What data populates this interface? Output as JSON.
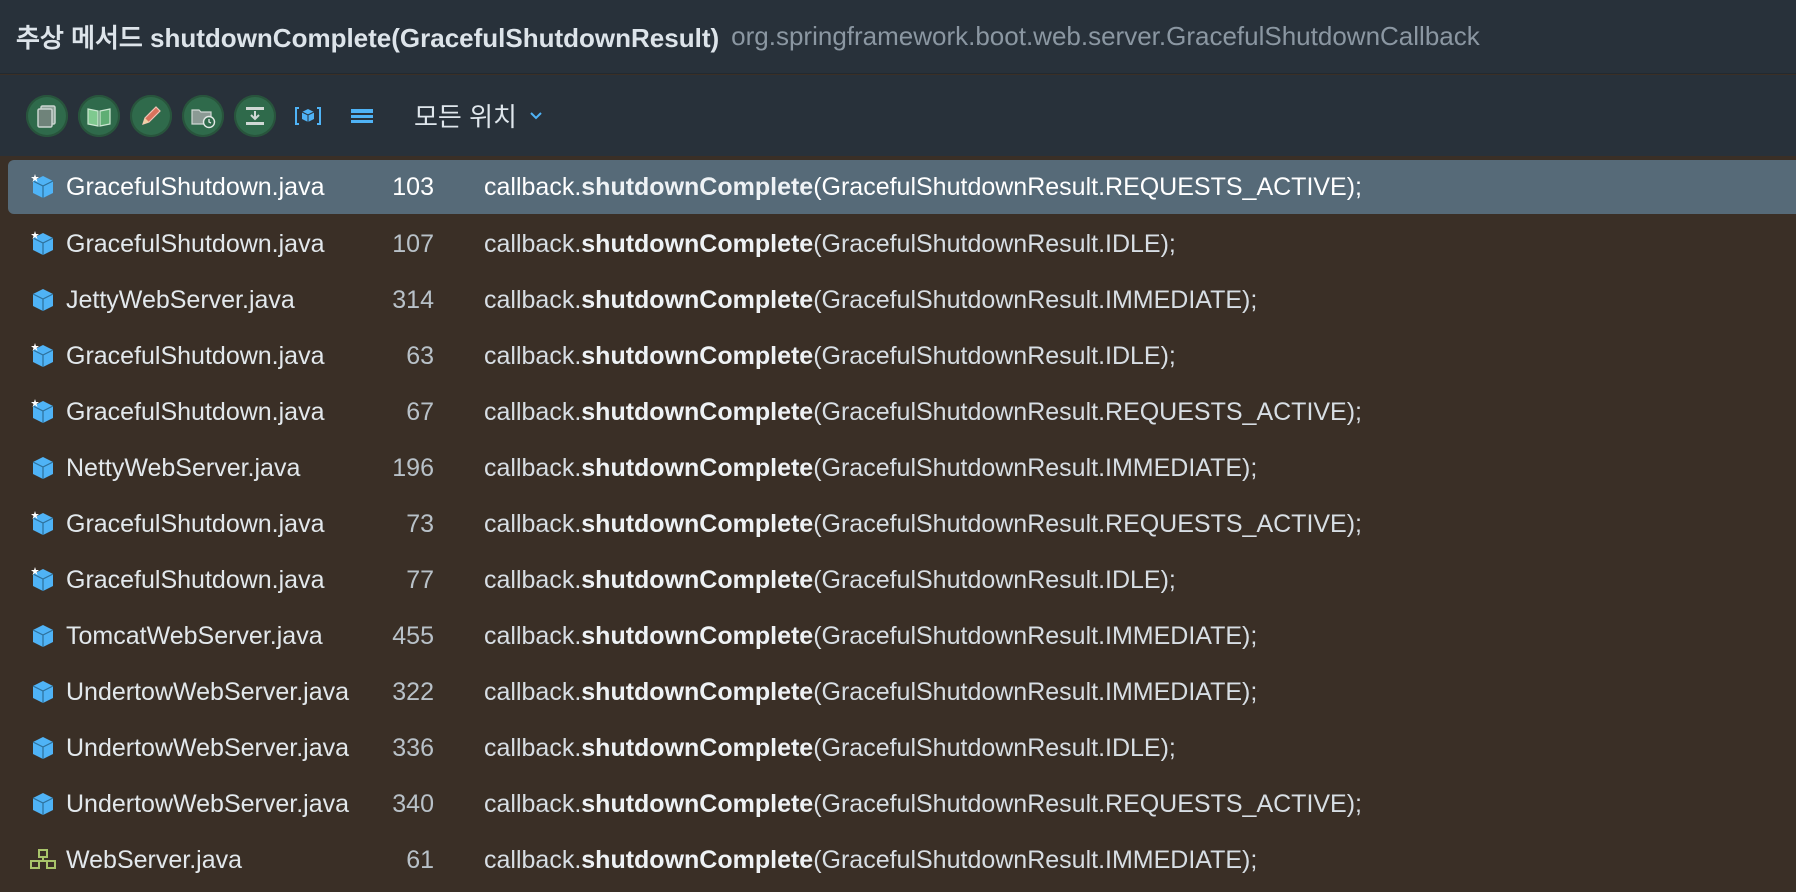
{
  "header": {
    "title": "추상 메서드 shutdownComplete(GracefulShutdownResult)",
    "subtitle": "org.springframework.boot.web.server.GracefulShutdownCallback"
  },
  "toolbar": {
    "buttons": [
      "copy-icon",
      "book-icon",
      "pencil-icon",
      "folder-clock-icon",
      "merge-download-icon"
    ],
    "scope_label": "모든 위치"
  },
  "colors": {
    "background": "#3a2f26",
    "header": "#28313a",
    "selected_row": "#566a78",
    "class_icon": "#4fb3f6",
    "interface_icon": "#a8c46a"
  },
  "usages": [
    {
      "file": "GracefulShutdown.java",
      "line": "103",
      "prefix": "callback.",
      "method": "shutdownComplete",
      "args": "(GracefulShutdownResult.REQUESTS_ACTIVE);",
      "icon": "nested-class-icon"
    },
    {
      "file": "GracefulShutdown.java",
      "line": "107",
      "prefix": "callback.",
      "method": "shutdownComplete",
      "args": "(GracefulShutdownResult.IDLE);",
      "icon": "nested-class-icon"
    },
    {
      "file": "JettyWebServer.java",
      "line": "314",
      "prefix": "callback.",
      "method": "shutdownComplete",
      "args": "(GracefulShutdownResult.IMMEDIATE);",
      "icon": "class-icon"
    },
    {
      "file": "GracefulShutdown.java",
      "line": "63",
      "prefix": "callback.",
      "method": "shutdownComplete",
      "args": "(GracefulShutdownResult.IDLE);",
      "icon": "nested-class-icon"
    },
    {
      "file": "GracefulShutdown.java",
      "line": "67",
      "prefix": "callback.",
      "method": "shutdownComplete",
      "args": "(GracefulShutdownResult.REQUESTS_ACTIVE);",
      "icon": "nested-class-icon"
    },
    {
      "file": "NettyWebServer.java",
      "line": "196",
      "prefix": "callback.",
      "method": "shutdownComplete",
      "args": "(GracefulShutdownResult.IMMEDIATE);",
      "icon": "class-icon"
    },
    {
      "file": "GracefulShutdown.java",
      "line": "73",
      "prefix": "callback.",
      "method": "shutdownComplete",
      "args": "(GracefulShutdownResult.REQUESTS_ACTIVE);",
      "icon": "nested-class-icon"
    },
    {
      "file": "GracefulShutdown.java",
      "line": "77",
      "prefix": "callback.",
      "method": "shutdownComplete",
      "args": "(GracefulShutdownResult.IDLE);",
      "icon": "nested-class-icon"
    },
    {
      "file": "TomcatWebServer.java",
      "line": "455",
      "prefix": "callback.",
      "method": "shutdownComplete",
      "args": "(GracefulShutdownResult.IMMEDIATE);",
      "icon": "class-icon"
    },
    {
      "file": "UndertowWebServer.java",
      "line": "322",
      "prefix": "callback.",
      "method": "shutdownComplete",
      "args": "(GracefulShutdownResult.IMMEDIATE);",
      "icon": "class-icon"
    },
    {
      "file": "UndertowWebServer.java",
      "line": "336",
      "prefix": "callback.",
      "method": "shutdownComplete",
      "args": "(GracefulShutdownResult.IDLE);",
      "icon": "class-icon"
    },
    {
      "file": "UndertowWebServer.java",
      "line": "340",
      "prefix": "callback.",
      "method": "shutdownComplete",
      "args": "(GracefulShutdownResult.REQUESTS_ACTIVE);",
      "icon": "class-icon"
    },
    {
      "file": "WebServer.java",
      "line": "61",
      "prefix": "callback.",
      "method": "shutdownComplete",
      "args": "(GracefulShutdownResult.IMMEDIATE);",
      "icon": "interface-icon"
    }
  ]
}
